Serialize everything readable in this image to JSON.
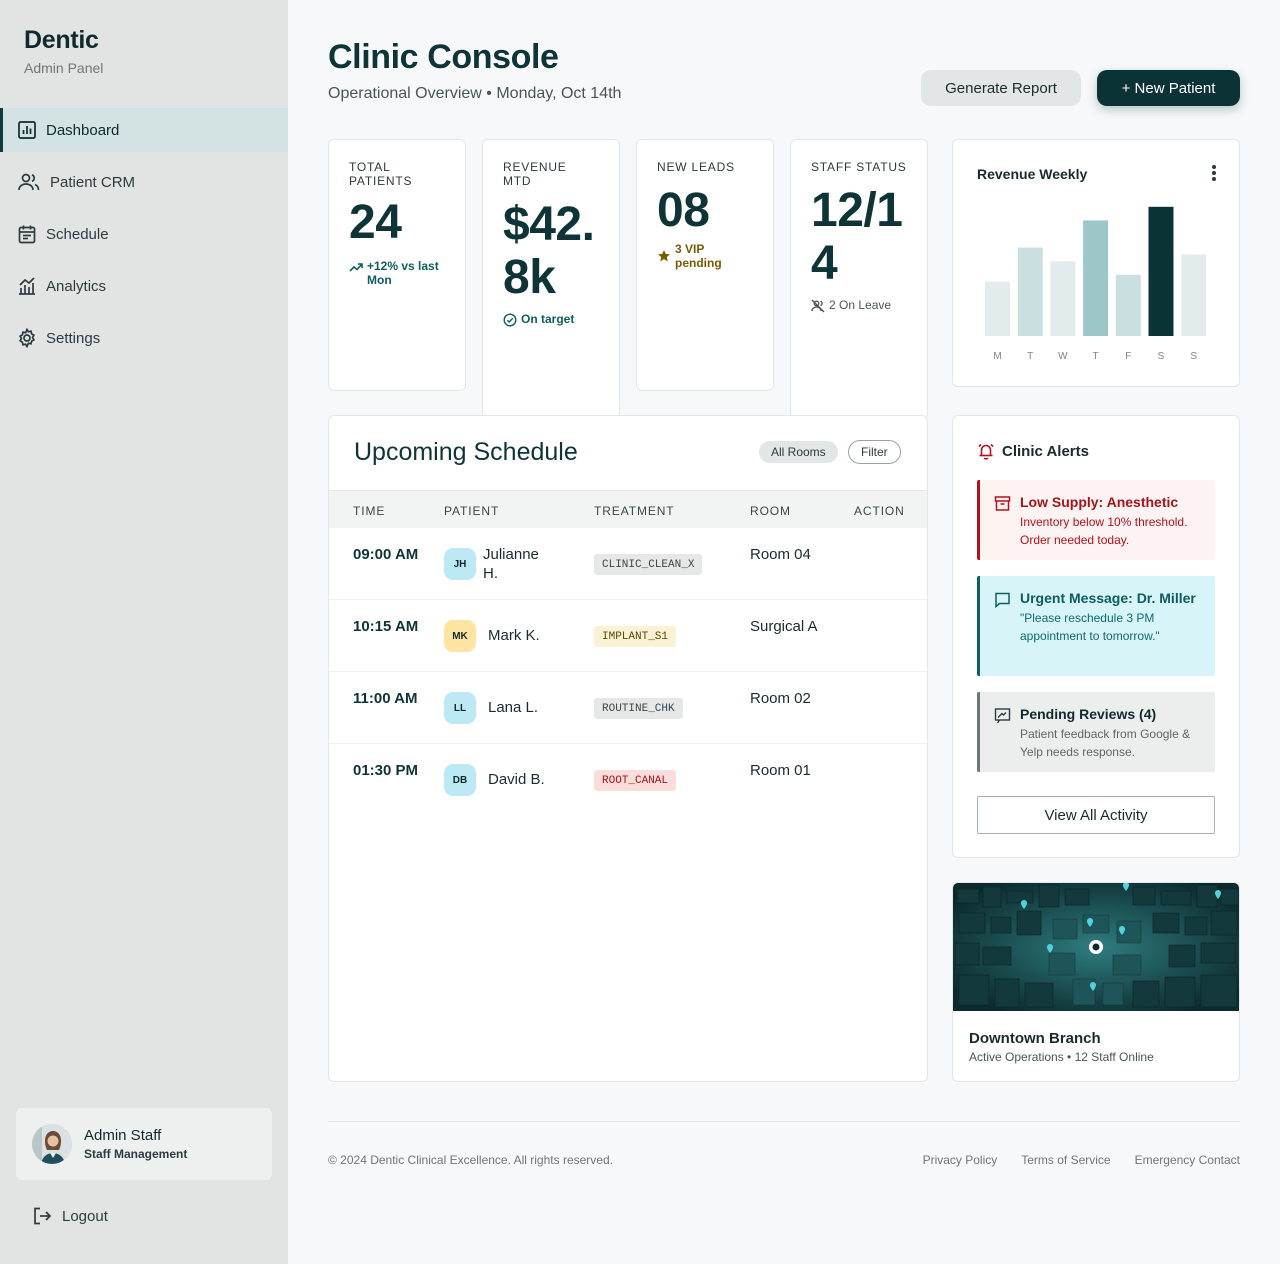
{
  "brand": {
    "name": "Dentic",
    "subtitle": "Admin Panel"
  },
  "nav": [
    {
      "label": "Dashboard",
      "icon": "bar-chart-icon",
      "active": true
    },
    {
      "label": "Patient CRM",
      "icon": "users-icon"
    },
    {
      "label": "Schedule",
      "icon": "calendar-icon"
    },
    {
      "label": "Analytics",
      "icon": "analytics-icon"
    },
    {
      "label": "Settings",
      "icon": "gear-icon"
    }
  ],
  "profile": {
    "name": "Admin Staff",
    "role": "Staff Management"
  },
  "logout_label": "Logout",
  "header": {
    "title": "Clinic Console",
    "subtitle": "Operational Overview • Monday, Oct 14th",
    "report_button": "Generate Report",
    "new_patient_button": "+ New Patient"
  },
  "stats": {
    "total_patients": {
      "label": "TOTAL PATIENTS",
      "value": "24",
      "note": "+12% vs last Mon"
    },
    "revenue": {
      "label": "REVENUE MTD",
      "value": "$42.8k",
      "note": "On target"
    },
    "leads": {
      "label": "NEW LEADS",
      "value": "08",
      "note": "3 VIP pending"
    },
    "staff": {
      "label": "STAFF STATUS",
      "value": "12/14",
      "note": "2 On Leave"
    }
  },
  "schedule": {
    "title": "Upcoming Schedule",
    "all_rooms": "All Rooms",
    "filter": "Filter",
    "columns": [
      "TIME",
      "PATIENT",
      "TREATMENT",
      "ROOM",
      "ACTION"
    ],
    "rows": [
      {
        "time": "09:00 AM",
        "initials": "JH",
        "patient": "Julianne H.",
        "treatment": "CLINIC_CLEAN_X",
        "room": "Room 04"
      },
      {
        "time": "10:15 AM",
        "initials": "MK",
        "patient": "Mark K.",
        "treatment": "IMPLANT_S1",
        "room": "Surgical A"
      },
      {
        "time": "11:00 AM",
        "initials": "LL",
        "patient": "Lana L.",
        "treatment": "ROUTINE_CHK",
        "room": "Room 02"
      },
      {
        "time": "01:30 PM",
        "initials": "DB",
        "patient": "David B.",
        "treatment": "ROOT_CANAL",
        "room": "Room 01"
      }
    ]
  },
  "revenue_chart": {
    "title": "Revenue Weekly",
    "chart_data": {
      "type": "bar",
      "categories": [
        "M",
        "T",
        "W",
        "T",
        "F",
        "S",
        "S"
      ],
      "values": [
        40,
        65,
        55,
        85,
        45,
        95,
        60
      ],
      "ylim": [
        0,
        100
      ],
      "colors": [
        "#e3eced",
        "#c9dfe0",
        "#e3eced",
        "#9cc6c8",
        "#c9dfe0",
        "#0b3336",
        "#e3eced"
      ]
    }
  },
  "alerts": {
    "title": "Clinic Alerts",
    "items": [
      {
        "title": "Low Supply: Anesthetic",
        "body": "Inventory below 10% threshold. Order needed today."
      },
      {
        "title": "Urgent Message: Dr. Miller",
        "body": "\"Please reschedule 3 PM appointment to tomorrow.\""
      },
      {
        "title": "Pending Reviews (4)",
        "body": "Patient feedback from Google & Yelp needs response."
      }
    ],
    "view_all": "View All Activity"
  },
  "branch": {
    "name": "Downtown Branch",
    "status": "Active Operations • 12 Staff Online"
  },
  "footer": {
    "copyright": "© 2024 Dentic Clinical Excellence. All rights reserved.",
    "links": [
      "Privacy Policy",
      "Terms of Service",
      "Emergency Contact"
    ]
  }
}
